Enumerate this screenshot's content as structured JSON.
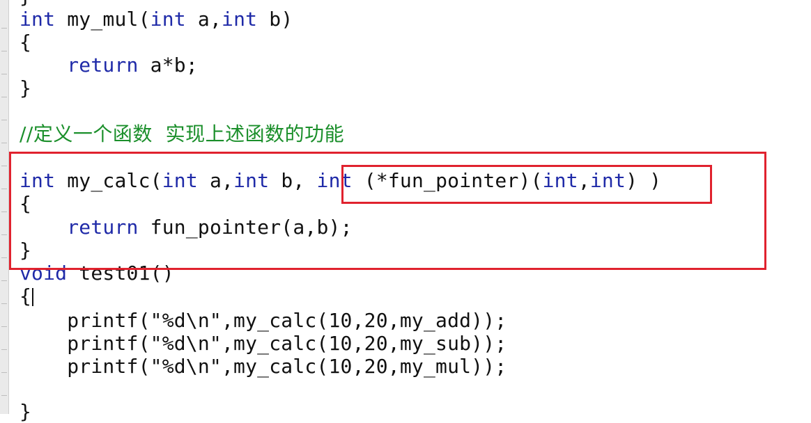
{
  "code": {
    "top_brace": "}",
    "l01": {
      "t1": "int",
      "t2": " my_mul(",
      "t3": "int",
      "t4": " a,",
      "t5": "int",
      "t6": " b)"
    },
    "l02": "{",
    "l03": {
      "t1": "    ",
      "t2": "return",
      "t3": " a*b;"
    },
    "l04": "}",
    "l05": "//定义一个函数  实现上述函数的功能",
    "l06": {
      "t1": "int",
      "t2": " my_calc(",
      "t3": "int",
      "t4": " a,",
      "t5": "int",
      "t6": " b, ",
      "t7": "int",
      "t8": " (*fun_pointer)(",
      "t9": "int",
      "t10": ",",
      "t11": "int",
      "t12": ") )"
    },
    "l07": "{",
    "l08": {
      "t1": "    ",
      "t2": "return",
      "t3": " fun_pointer(a,b);"
    },
    "l09": "}",
    "l10": {
      "t1": "void",
      "t2": " test01()"
    },
    "l11": "{",
    "l12": "    printf(\"%d\\n\",my_calc(10,20,my_add));",
    "l13": "    printf(\"%d\\n\",my_calc(10,20,my_sub));",
    "l14": "    printf(\"%d\\n\",my_calc(10,20,my_mul));",
    "l16": "}"
  },
  "colors": {
    "keyword": "#1f2aa8",
    "comment": "#1b8f2b",
    "text": "#111111",
    "highlight_box": "#e0222e"
  }
}
